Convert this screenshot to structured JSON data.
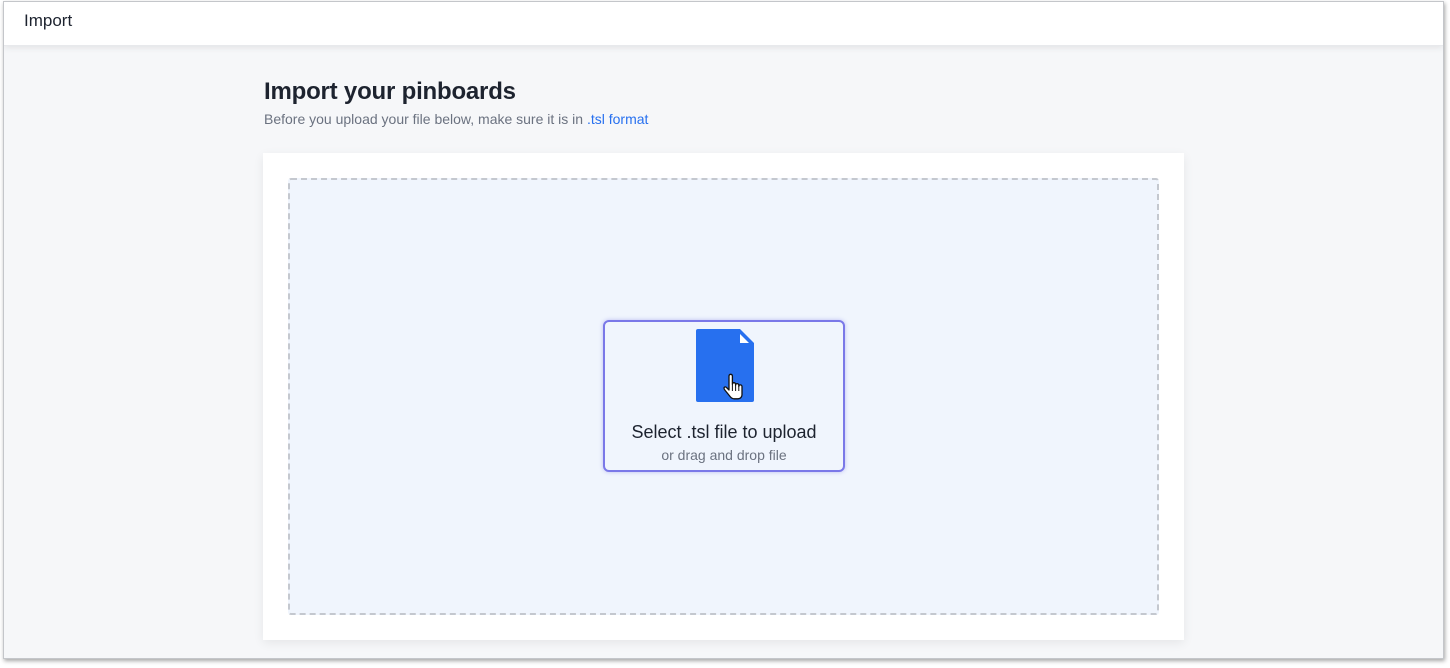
{
  "header": {
    "title": "Import"
  },
  "main": {
    "heading": "Import your pinboards",
    "subtext_prefix": "Before you upload your file below, make sure it is in ",
    "subtext_link": ".tsl format",
    "upload": {
      "title": "Select .tsl file to upload",
      "subtitle": "or drag and drop file",
      "icon": "file-icon",
      "cursor_icon": "hand-pointer-icon"
    }
  },
  "colors": {
    "accent": "#2770ef",
    "file_icon": "#2770ef",
    "upload_border": "#7a78e8",
    "dropzone_bg": "#f0f5fd"
  }
}
